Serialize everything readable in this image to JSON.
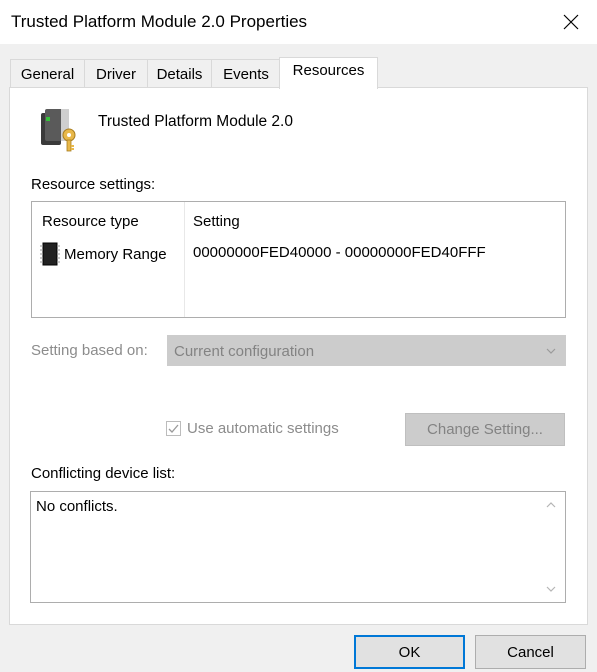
{
  "window": {
    "title": "Trusted Platform Module 2.0 Properties",
    "close_icon": "close-icon"
  },
  "tabs": [
    {
      "label": "General",
      "active": false
    },
    {
      "label": "Driver",
      "active": false
    },
    {
      "label": "Details",
      "active": false
    },
    {
      "label": "Events",
      "active": false
    },
    {
      "label": "Resources",
      "active": true
    }
  ],
  "device": {
    "name": "Trusted Platform Module 2.0",
    "icon": "tpm-device-icon"
  },
  "resource_settings": {
    "label": "Resource settings:",
    "columns": [
      "Resource type",
      "Setting"
    ],
    "rows": [
      {
        "type": "Memory Range",
        "setting": "00000000FED40000 - 00000000FED40FFF",
        "icon": "memory-chip-icon"
      }
    ]
  },
  "setting_based_on": {
    "label": "Setting based on:",
    "value": "Current configuration",
    "enabled": false
  },
  "automatic_settings": {
    "label": "Use automatic settings",
    "checked": true,
    "enabled": false
  },
  "change_setting_button": "Change Setting...",
  "conflicts": {
    "label": "Conflicting device list:",
    "text": "No conflicts."
  },
  "buttons": {
    "ok": "OK",
    "cancel": "Cancel"
  },
  "colors": {
    "accent": "#0078d7",
    "disabled_text": "#838383",
    "window_bg": "#f0f0f0"
  }
}
